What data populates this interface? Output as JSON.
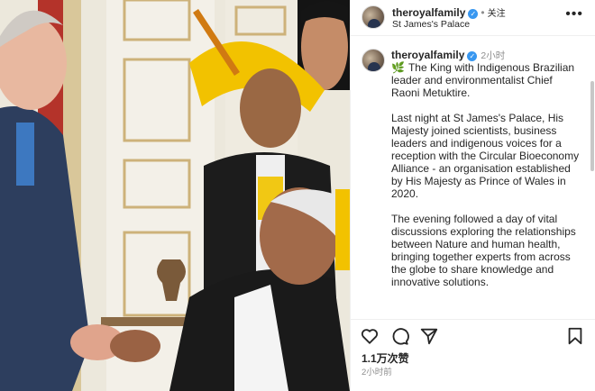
{
  "header": {
    "username": "theroyalfamily",
    "verified_icon": "verified-badge-icon",
    "follow_label": "关注",
    "location": "St James's Palace",
    "more_icon": "more-options-icon"
  },
  "post": {
    "username": "theroyalfamily",
    "time_ago": "2小时",
    "caption_emoji": "🌿",
    "paragraphs": [
      "The King with Indigenous Brazilian leader and environmentalist Chief Raoni Metuktire.",
      "Last night at St James's Palace, His Majesty joined scientists, business leaders and indigenous voices for a reception with the Circular Bioeconomy Alliance - an organisation established by His Majesty as Prince of Wales in 2020.",
      "The evening followed a day of vital discussions exploring the relationships between Nature and human health, bringing together experts from across the globe to share knowledge and innovative solutions."
    ]
  },
  "actions": {
    "icons": [
      "heart-icon",
      "comment-icon",
      "share-icon",
      "bookmark-icon"
    ],
    "likes": "1.1万次赞",
    "posted_ago": "2小时前"
  },
  "colors": {
    "verified": "#3897f0",
    "text": "#262626",
    "secondary": "#8e8e8e",
    "headdress": "#f2c200"
  }
}
